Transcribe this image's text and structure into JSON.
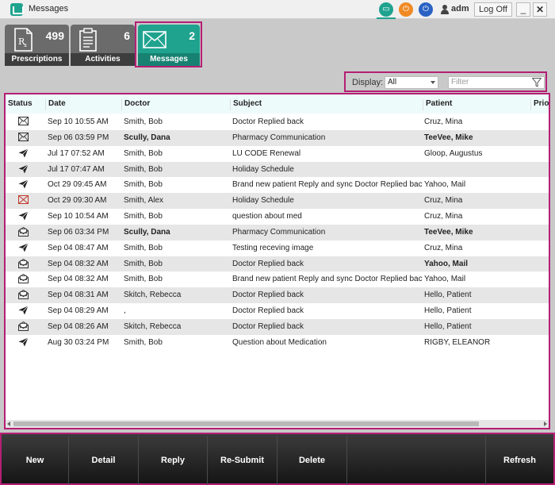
{
  "window": {
    "title": "Messages",
    "user": "adm",
    "logoff_label": "Log Off",
    "minimize_glyph": "_",
    "close_glyph": "✕"
  },
  "tiles": [
    {
      "label": "Prescriptions",
      "count": "499",
      "icon": "prescription-icon"
    },
    {
      "label": "Activities",
      "count": "6",
      "icon": "clipboard-icon"
    },
    {
      "label": "Messages",
      "count": "2",
      "icon": "envelope-icon"
    }
  ],
  "filter": {
    "display_label": "Display:",
    "display_value": "All",
    "filter_placeholder": "Filter"
  },
  "table": {
    "columns": [
      "Status",
      "Date",
      "Doctor",
      "Subject",
      "Patient",
      "Prio"
    ],
    "rows": [
      {
        "status": "envelope-closed",
        "date": "Sep 10 10:55 AM",
        "doctor": "Smith, Bob",
        "subject": "Doctor Replied back",
        "patient": "Cruz, Mina",
        "bold_doctor": false,
        "bold_patient": false
      },
      {
        "status": "envelope-closed",
        "date": "Sep 06 03:59 PM",
        "doctor": "Scully, Dana",
        "subject": "Pharmacy Communication",
        "patient": "TeeVee, Mike",
        "bold_doctor": true,
        "bold_patient": true
      },
      {
        "status": "sent",
        "date": "Jul 17 07:52 AM",
        "doctor": "Smith, Bob",
        "subject": "LU CODE Renewal",
        "patient": "Gloop, Augustus",
        "bold_doctor": false,
        "bold_patient": false
      },
      {
        "status": "sent",
        "date": "Jul 17 07:47 AM",
        "doctor": "Smith, Bob",
        "subject": "Holiday Schedule",
        "patient": "",
        "bold_doctor": false,
        "bold_patient": false
      },
      {
        "status": "sent",
        "date": "Oct 29 09:45 AM",
        "doctor": "Smith, Bob",
        "subject": "Brand new patient Reply and sync Doctor Replied back",
        "patient": "Yahoo, Mail",
        "bold_doctor": false,
        "bold_patient": false
      },
      {
        "status": "envelope-error",
        "date": "Oct 29 09:30 AM",
        "doctor": "Smith, Alex",
        "subject": "Holiday Schedule",
        "patient": "Cruz, Mina",
        "bold_doctor": false,
        "bold_patient": false
      },
      {
        "status": "sent",
        "date": "Sep 10 10:54 AM",
        "doctor": "Smith, Bob",
        "subject": "question about med",
        "patient": "Cruz, Mina",
        "bold_doctor": false,
        "bold_patient": false
      },
      {
        "status": "envelope-open",
        "date": "Sep 06 03:34 PM",
        "doctor": "Scully, Dana",
        "subject": "Pharmacy Communication",
        "patient": "TeeVee, Mike",
        "bold_doctor": true,
        "bold_patient": true
      },
      {
        "status": "sent",
        "date": "Sep 04 08:47 AM",
        "doctor": "Smith, Bob",
        "subject": "Testing receving image",
        "patient": "Cruz, Mina",
        "bold_doctor": false,
        "bold_patient": false
      },
      {
        "status": "envelope-open",
        "date": "Sep 04 08:32 AM",
        "doctor": "Smith, Bob",
        "subject": "Doctor Replied back",
        "patient": "Yahoo, Mail",
        "bold_doctor": false,
        "bold_patient": true
      },
      {
        "status": "envelope-open",
        "date": "Sep 04 08:32 AM",
        "doctor": "Smith, Bob",
        "subject": "Brand new patient Reply and sync Doctor Replied back",
        "patient": "Yahoo, Mail",
        "bold_doctor": false,
        "bold_patient": false
      },
      {
        "status": "envelope-open",
        "date": "Sep 04 08:31 AM",
        "doctor": "Skitch, Rebecca",
        "subject": "Doctor Replied back",
        "patient": "Hello, Patient",
        "bold_doctor": false,
        "bold_patient": false
      },
      {
        "status": "sent",
        "date": "Sep 04 08:29 AM",
        "doctor": ",",
        "subject": "Doctor Replied back",
        "patient": "Hello, Patient",
        "bold_doctor": false,
        "bold_patient": false
      },
      {
        "status": "envelope-open",
        "date": "Sep 04 08:26 AM",
        "doctor": "Skitch, Rebecca",
        "subject": "Doctor Replied back",
        "patient": "Hello, Patient",
        "bold_doctor": false,
        "bold_patient": false
      },
      {
        "status": "sent",
        "date": "Aug 30 03:24 PM",
        "doctor": "Smith, Bob",
        "subject": "Question about Medication",
        "patient": "RIGBY, ELEANOR",
        "bold_doctor": false,
        "bold_patient": false
      }
    ]
  },
  "toolbar": {
    "new_label": "New",
    "detail_label": "Detail",
    "reply_label": "Reply",
    "resubmit_label": "Re-Submit",
    "delete_label": "Delete",
    "refresh_label": "Refresh"
  },
  "colors": {
    "accent": "#1fa38f",
    "highlight": "#b51f74",
    "tile_bg": "#6b6b6b",
    "toolbar_bg": "#1c1c1c"
  }
}
